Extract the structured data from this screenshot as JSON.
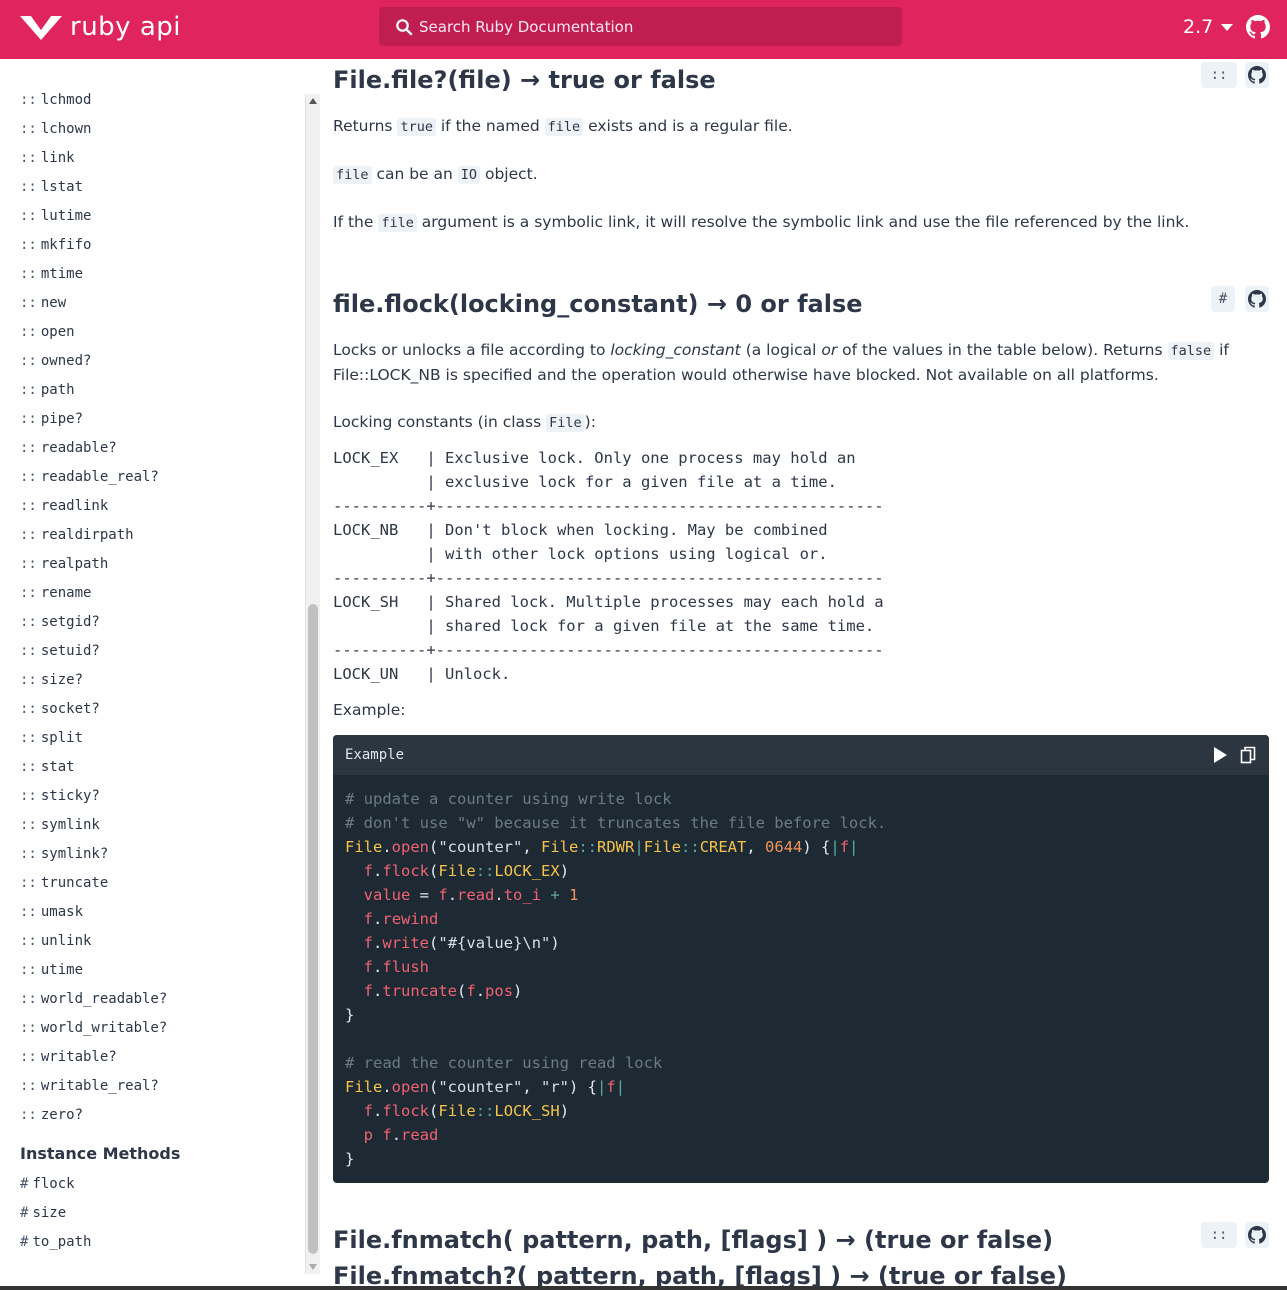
{
  "header": {
    "logo_text": "ruby api",
    "search_placeholder": "Search Ruby Documentation",
    "version": "2.7",
    "brand_color": "#e0245e"
  },
  "sidebar": {
    "class_methods": [
      "lchmod",
      "lchown",
      "link",
      "lstat",
      "lutime",
      "mkfifo",
      "mtime",
      "new",
      "open",
      "owned?",
      "path",
      "pipe?",
      "readable?",
      "readable_real?",
      "readlink",
      "realdirpath",
      "realpath",
      "rename",
      "setgid?",
      "setuid?",
      "size?",
      "socket?",
      "split",
      "stat",
      "sticky?",
      "symlink",
      "symlink?",
      "truncate",
      "umask",
      "unlink",
      "utime",
      "world_readable?",
      "world_writable?",
      "writable?",
      "writable_real?",
      "zero?"
    ],
    "class_prefix": "::",
    "instance_heading": "Instance Methods",
    "instance_prefix": "#",
    "instance_methods": [
      "flock",
      "size",
      "to_path"
    ]
  },
  "method_file": {
    "title": "File.file?(file) → true or false",
    "anchor_label": "::",
    "p1": {
      "a": "Returns ",
      "c1": "true",
      "b": " if the named ",
      "c2": "file",
      "c": " exists and is a regular file."
    },
    "p2": {
      "c1": "file",
      "a": " can be an ",
      "c2": "IO",
      "b": " object."
    },
    "p3": {
      "a": "If the ",
      "c1": "file",
      "b": " argument is a symbolic link, it will resolve the symbolic link and use the file referenced by the link."
    }
  },
  "method_flock": {
    "title": "file.flock(locking_constant) → 0 or false",
    "anchor_label": "#",
    "p1": {
      "a": "Locks or unlocks a file according to ",
      "em1": "locking_constant",
      "b": " (a logical ",
      "em2": "or",
      "c": " of the values in the table below). Returns ",
      "c1": "false",
      "d": " if File::LOCK_NB is specified and the operation would otherwise have blocked. Not available on all platforms."
    },
    "p2": {
      "a": "Locking constants (in class ",
      "c1": "File",
      "b": "):"
    },
    "table": [
      "LOCK_EX   | Exclusive lock. Only one process may hold an",
      "          | exclusive lock for a given file at a time.",
      "----------+------------------------------------------------",
      "LOCK_NB   | Don't block when locking. May be combined",
      "          | with other lock options using logical or.",
      "----------+------------------------------------------------",
      "LOCK_SH   | Shared lock. Multiple processes may each hold a",
      "          | shared lock for a given file at the same time.",
      "----------+------------------------------------------------",
      "LOCK_UN   | Unlock."
    ],
    "example_label": "Example:",
    "code_header": "Example"
  },
  "method_fnmatch": {
    "title1": "File.fnmatch( pattern, path, [flags] ) → (true or false)",
    "title2": "File.fnmatch?( pattern, path, [flags] ) → (true or false)",
    "anchor_label": "::"
  }
}
